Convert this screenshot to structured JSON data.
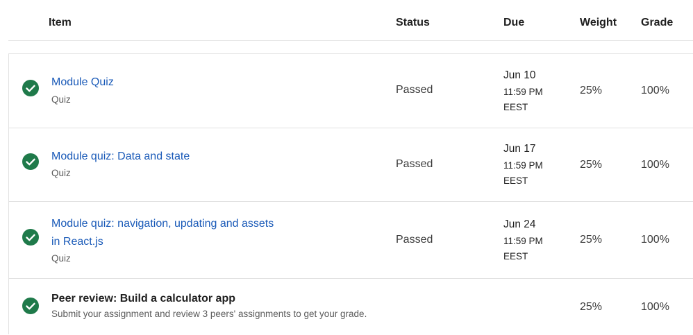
{
  "columns": {
    "item": "Item",
    "status": "Status",
    "due": "Due",
    "weight": "Weight",
    "grade": "Grade"
  },
  "rows": [
    {
      "title_lines": [
        "Module Quiz"
      ],
      "type": "Quiz",
      "status": "Passed",
      "due_date": "Jun 10",
      "due_time": "11:59 PM",
      "due_tz": "EEST",
      "weight": "25%",
      "grade": "100%",
      "icon": "check-circle-icon"
    },
    {
      "title_lines": [
        "Module quiz: Data and state"
      ],
      "type": "Quiz",
      "status": "Passed",
      "due_date": "Jun 17",
      "due_time": "11:59 PM",
      "due_tz": "EEST",
      "weight": "25%",
      "grade": "100%",
      "icon": "check-circle-icon"
    },
    {
      "title_lines": [
        "Module quiz: navigation, updating and assets",
        "in React.js"
      ],
      "type": "Quiz",
      "status": "Passed",
      "due_date": "Jun 24",
      "due_time": "11:59 PM",
      "due_tz": "EEST",
      "weight": "25%",
      "grade": "100%",
      "icon": "check-circle-icon"
    },
    {
      "title_lines": [
        "Peer review: Build a calculator app"
      ],
      "type": "Submit your assignment and review 3 peers' assignments to get your grade.",
      "status": "",
      "weight": "25%",
      "grade": "100%",
      "icon": "check-circle-icon"
    }
  ],
  "colors": {
    "link": "#1a5ab8",
    "check": "#1f7a4a",
    "border": "#e1e1e1"
  }
}
